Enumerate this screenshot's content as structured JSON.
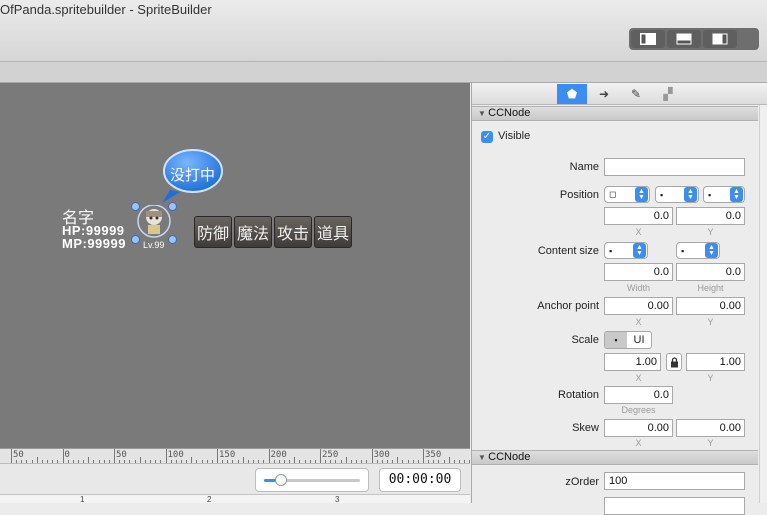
{
  "window": {
    "title": "OfPanda.spritebuilder - SpriteBuilder",
    "layout_buttons": [
      "left-panel-icon",
      "bottom-panel-icon",
      "right-panel-icon"
    ]
  },
  "canvas": {
    "background": "#7a7a7a",
    "character": {
      "name": "名字",
      "hp": "HP:99999",
      "mp": "MP:99999",
      "level": "Lv.99",
      "speech": "没打中"
    },
    "commands": [
      "防御",
      "魔法",
      "攻击",
      "道具"
    ]
  },
  "ruler": {
    "labels": [
      "50",
      "0",
      "50",
      "100",
      "150",
      "200",
      "250",
      "300",
      "350",
      "40"
    ]
  },
  "timeline": {
    "time": "00:00:00",
    "track_labels": [
      "1",
      "2",
      "3"
    ],
    "zoom_level": 0.18
  },
  "inspector": {
    "tabs": [
      "node-properties-icon",
      "code-connections-icon",
      "physics-pin-icon",
      "template-icon"
    ],
    "section1": "CCNode",
    "visible_label": "Visible",
    "visible_checked": true,
    "name": {
      "label": "Name",
      "value": ""
    },
    "position": {
      "label": "Position",
      "x": "0.0",
      "y": "0.0",
      "x_label": "X",
      "y_label": "Y",
      "popup_values": [
        "◻",
        "▪",
        "▪"
      ]
    },
    "content_size": {
      "label": "Content size",
      "width": "0.0",
      "height": "0.0",
      "w_label": "Width",
      "h_label": "Height",
      "popup_values": [
        "▪",
        "▪"
      ]
    },
    "anchor_point": {
      "label": "Anchor point",
      "x": "0.00",
      "y": "0.00",
      "x_label": "X",
      "y_label": "Y"
    },
    "scale": {
      "label": "Scale",
      "type_options": [
        "▪",
        "UI"
      ],
      "x": "1.00",
      "y": "1.00",
      "x_label": "X",
      "y_label": "Y"
    },
    "rotation": {
      "label": "Rotation",
      "value": "0.0",
      "unit": "Degrees"
    },
    "skew": {
      "label": "Skew",
      "x": "0.00",
      "y": "0.00",
      "x_label": "X",
      "y_label": "Y"
    },
    "section2": "CCNode",
    "zorder": {
      "label": "zOrder",
      "value": "100"
    }
  },
  "colors": {
    "accent": "#3b8ef0",
    "bubble": "#2e7de0"
  }
}
